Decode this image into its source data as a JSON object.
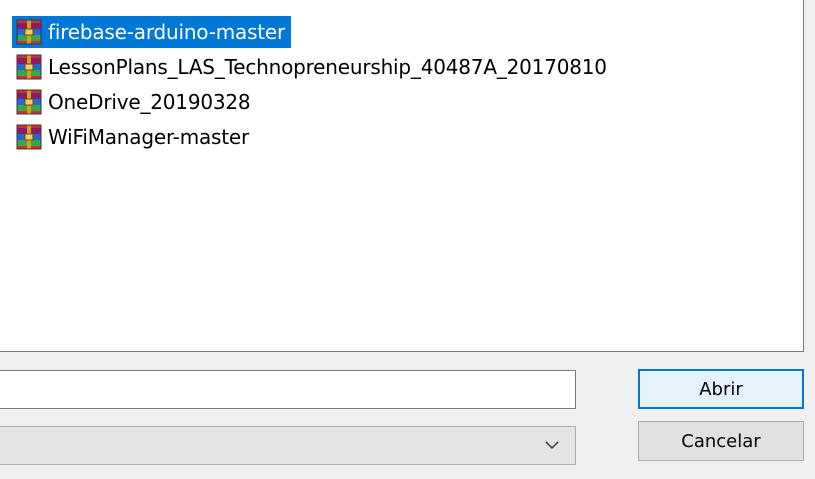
{
  "file_list": {
    "items": [
      {
        "name": "firebase-arduino-master",
        "icon": "winrar-archive-icon",
        "selected": true
      },
      {
        "name": "LessonPlans_LAS_Technopreneurship_40487A_20170810",
        "icon": "winrar-archive-icon",
        "selected": false
      },
      {
        "name": "OneDrive_20190328",
        "icon": "winrar-archive-icon",
        "selected": false
      },
      {
        "name": "WiFiManager-master",
        "icon": "winrar-archive-icon",
        "selected": false
      }
    ]
  },
  "filename_field": {
    "value": ""
  },
  "filetype_select": {
    "value": ""
  },
  "buttons": {
    "open_label": "Abrir",
    "cancel_label": "Cancelar"
  },
  "colors": {
    "selection": "#0078d7",
    "default_button_bg": "#e5f1fb",
    "button_bg": "#e1e1e1"
  }
}
